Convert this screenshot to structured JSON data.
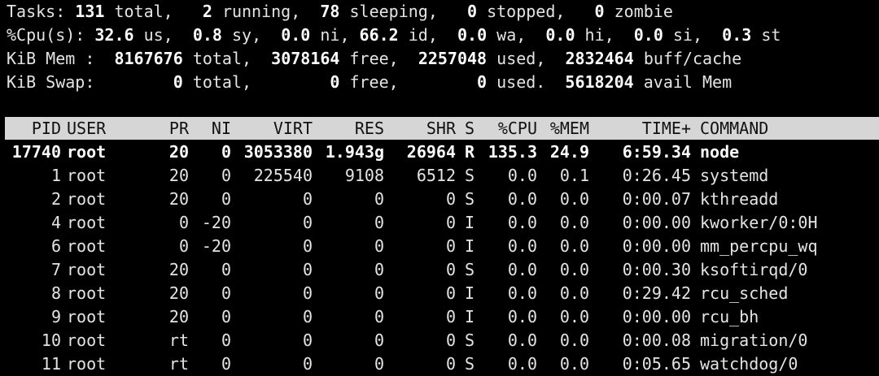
{
  "summary": {
    "tasks": {
      "label": "Tasks:",
      "total": "131",
      "total_label": "total,",
      "running": "2",
      "running_label": "running,",
      "sleeping": "78",
      "sleeping_label": "sleeping,",
      "stopped": "0",
      "stopped_label": "stopped,",
      "zombie": "0",
      "zombie_label": "zombie"
    },
    "cpu": {
      "label": "%Cpu(s):",
      "us": "32.6",
      "us_label": "us,",
      "sy": "0.8",
      "sy_label": "sy,",
      "ni": "0.0",
      "ni_label": "ni,",
      "id": "66.2",
      "id_label": "id,",
      "wa": "0.0",
      "wa_label": "wa,",
      "hi": "0.0",
      "hi_label": "hi,",
      "si": "0.0",
      "si_label": "si,",
      "st": "0.3",
      "st_label": "st"
    },
    "mem": {
      "label": "KiB Mem :",
      "total": "8167676",
      "total_label": "total,",
      "free": "3078164",
      "free_label": "free,",
      "used": "2257048",
      "used_label": "used,",
      "buff": "2832464",
      "buff_label": "buff/cache"
    },
    "swap": {
      "label": "KiB Swap:",
      "total": "0",
      "total_label": "total,",
      "free": "0",
      "free_label": "free,",
      "used": "0",
      "used_label": "used.",
      "avail": "5618204",
      "avail_label": "avail Mem"
    }
  },
  "columns": [
    "PID",
    "USER",
    "PR",
    "NI",
    "VIRT",
    "RES",
    "SHR",
    "S",
    "%CPU",
    "%MEM",
    "TIME+",
    "COMMAND"
  ],
  "processes": [
    [
      "17740",
      "root",
      "20",
      "0",
      "3053380",
      "1.943g",
      "26964",
      "R",
      "135.3",
      "24.9",
      "6:59.34",
      "node"
    ],
    [
      "1",
      "root",
      "20",
      "0",
      "225540",
      "9108",
      "6512",
      "S",
      "0.0",
      "0.1",
      "0:26.45",
      "systemd"
    ],
    [
      "2",
      "root",
      "20",
      "0",
      "0",
      "0",
      "0",
      "S",
      "0.0",
      "0.0",
      "0:00.07",
      "kthreadd"
    ],
    [
      "4",
      "root",
      "0",
      "-20",
      "0",
      "0",
      "0",
      "I",
      "0.0",
      "0.0",
      "0:00.00",
      "kworker/0:0H"
    ],
    [
      "6",
      "root",
      "0",
      "-20",
      "0",
      "0",
      "0",
      "I",
      "0.0",
      "0.0",
      "0:00.00",
      "mm_percpu_wq"
    ],
    [
      "7",
      "root",
      "20",
      "0",
      "0",
      "0",
      "0",
      "S",
      "0.0",
      "0.0",
      "0:00.30",
      "ksoftirqd/0"
    ],
    [
      "8",
      "root",
      "20",
      "0",
      "0",
      "0",
      "0",
      "I",
      "0.0",
      "0.0",
      "0:29.42",
      "rcu_sched"
    ],
    [
      "9",
      "root",
      "20",
      "0",
      "0",
      "0",
      "0",
      "I",
      "0.0",
      "0.0",
      "0:00.00",
      "rcu_bh"
    ],
    [
      "10",
      "root",
      "rt",
      "0",
      "0",
      "0",
      "0",
      "S",
      "0.0",
      "0.0",
      "0:00.08",
      "migration/0"
    ],
    [
      "11",
      "root",
      "rt",
      "0",
      "0",
      "0",
      "0",
      "S",
      "0.0",
      "0.0",
      "0:05.65",
      "watchdog/0"
    ]
  ]
}
